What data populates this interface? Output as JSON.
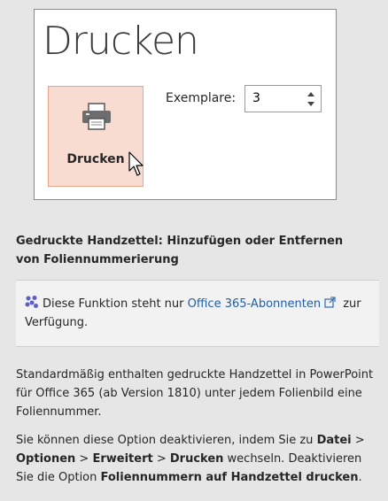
{
  "print_panel": {
    "title": "Drucken",
    "print_button_label": "Drucken",
    "copies_label": "Exemplare:",
    "copies_value": "3"
  },
  "article": {
    "heading": "Gedruckte Handzettel: Hinzufügen oder Entfernen von Foliennummerierung",
    "note": {
      "before_link": "Diese Funktion steht nur ",
      "link_text": "Office 365-Abonnenten",
      "after_link": " zur Verfügung."
    },
    "paragraph1": "Standardmäßig enthalten gedruckte Handzettel in PowerPoint für Office 365 (ab Version 1810) unter jedem Folienbild eine Foliennummer.",
    "paragraph2": {
      "t1": "Sie können diese Option deaktivieren, indem Sie zu ",
      "b1": "Datei",
      "t2": " > ",
      "b2": "Optionen",
      "t3": " > ",
      "b3": "Erweitert",
      "t4": " > ",
      "b4": "Drucken",
      "t5": " wechseln. Deaktivieren Sie die Option ",
      "b5": "Foliennummern auf Handzettel drucken",
      "t6": "."
    }
  },
  "colors": {
    "page_bg": "#e6e6e6",
    "print_button_bg": "#f8dcd2",
    "print_button_border": "#e8a48c",
    "link": "#1f5fa8",
    "office_icon": "#5b5fc7"
  },
  "icons": [
    "printer-icon",
    "mouse-cursor-icon",
    "spin-up-icon",
    "spin-down-icon",
    "office-icon",
    "external-link-icon"
  ]
}
